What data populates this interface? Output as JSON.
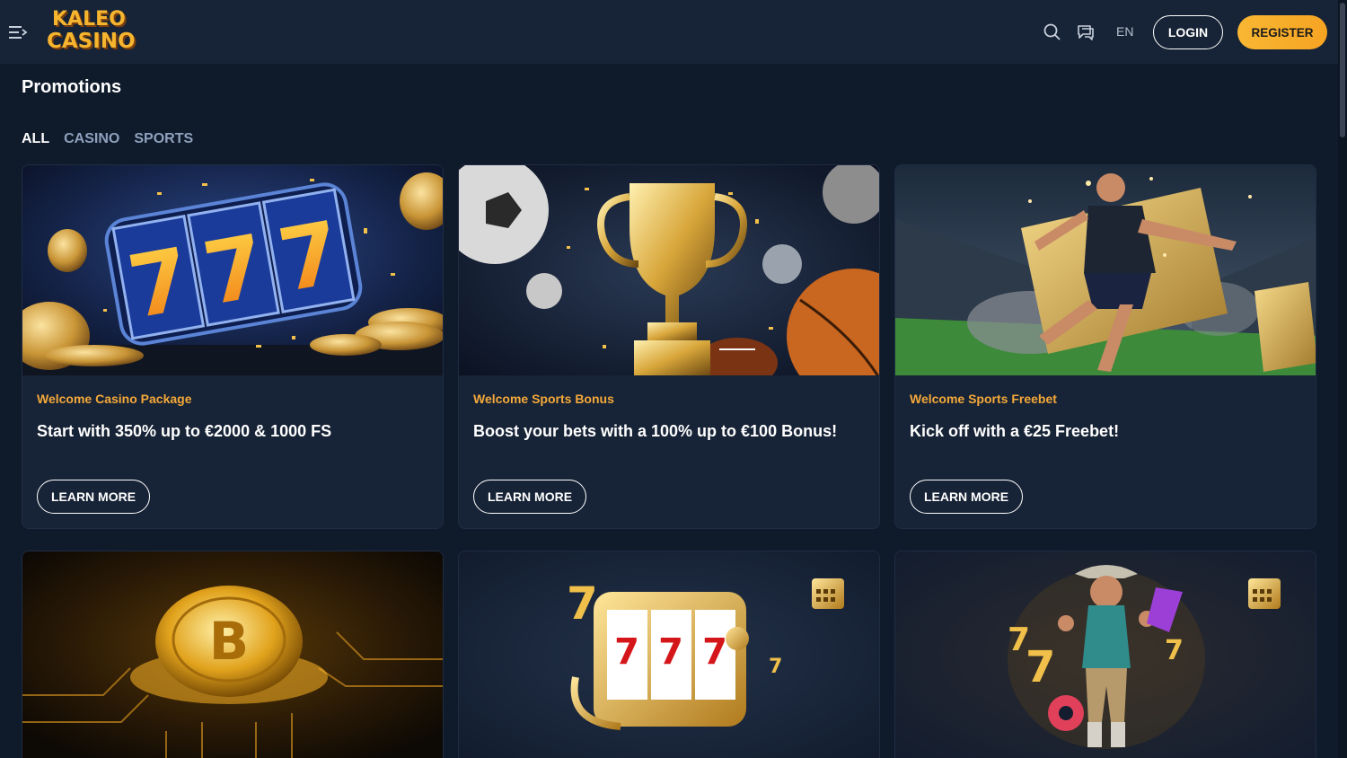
{
  "header": {
    "logo_line1": "KALEO",
    "logo_line2": "CASINO",
    "language": "EN",
    "login_label": "LOGIN",
    "register_label": "REGISTER"
  },
  "page": {
    "title": "Promotions"
  },
  "filters": [
    {
      "label": "ALL",
      "active": true
    },
    {
      "label": "CASINO",
      "active": false
    },
    {
      "label": "SPORTS",
      "active": false
    }
  ],
  "promotions": [
    {
      "category": "Welcome Casino Package",
      "title": "Start with 350% up to €2000 & 1000 FS",
      "cta": "LEARN MORE",
      "image": "slot-777-coins"
    },
    {
      "category": "Welcome Sports Bonus",
      "title": "Boost your bets with a 100% up to €100 Bonus!",
      "cta": "LEARN MORE",
      "image": "golden-trophy-balls"
    },
    {
      "category": "Welcome Sports Freebet",
      "title": "Kick off with a €25 Freebet!",
      "cta": "LEARN MORE",
      "image": "footballer-golden-ticket"
    },
    {
      "image": "bitcoin-coin-circuit"
    },
    {
      "image": "slot-machine-reload"
    },
    {
      "image": "cowboy-character"
    }
  ],
  "colors": {
    "background": "#0f1a2b",
    "header": "#172336",
    "card": "#172336",
    "accent": "#f4a93a",
    "register": "#f8b733"
  }
}
